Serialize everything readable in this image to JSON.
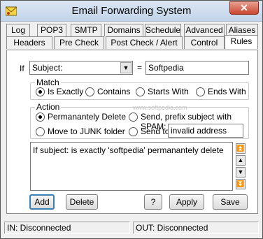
{
  "window": {
    "title": "Email Forwarding System",
    "close_label": "✕"
  },
  "tabs_row1": [
    "Log",
    "POP3",
    "SMTP",
    "Domains",
    "Schedule",
    "Advanced",
    "Aliases"
  ],
  "tabs_row2": [
    "Headers",
    "Pre Check",
    "Post Check / Alert",
    "Control",
    "Rules"
  ],
  "active_tab": "Rules",
  "rule": {
    "if_label": "If",
    "field_value": "Subject:",
    "equals_label": "=",
    "match_value": "Softpedia"
  },
  "match_group": {
    "title": "Match",
    "options": [
      "Is Exactly",
      "Contains",
      "Starts With",
      "Ends With"
    ],
    "selected": "Is Exactly"
  },
  "action_group": {
    "title": "Action",
    "opt_delete": "Permanantely Delete",
    "opt_spam": "Send, prefix subject with SPAM:",
    "opt_junk": "Move to JUNK folder",
    "opt_sendto": "Send to",
    "sendto_value": "invalid address",
    "selected": "Permanantely Delete"
  },
  "watermark": "www.softpedia.com",
  "rules_list": [
    "If subject: is exactly 'softpedia' permanantely delete"
  ],
  "move_buttons": {
    "top": "⏫",
    "up": "▲",
    "down": "▼",
    "bottom": "⏬"
  },
  "buttons": {
    "add": "Add",
    "delete": "Delete",
    "help": "?",
    "apply": "Apply",
    "save": "Save"
  },
  "status": {
    "in": "IN: Disconnected",
    "out": "OUT: Disconnected"
  }
}
